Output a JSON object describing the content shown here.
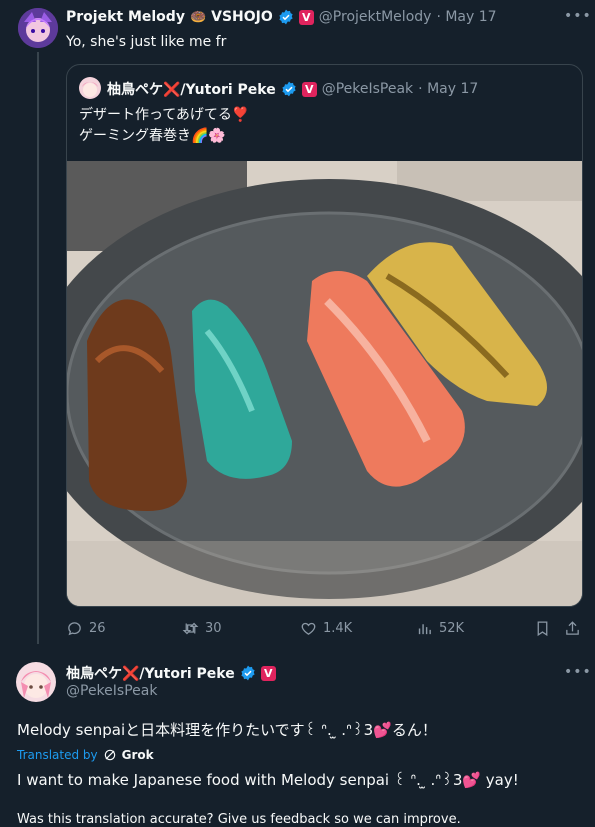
{
  "tweet1": {
    "author_name": "Projekt Melody",
    "author_suffix": "VSHOJO",
    "handle": "@ProjektMelody",
    "date": "· May 17",
    "text": "Yo, she's just like me fr",
    "affiliation_badge": "V"
  },
  "quoted": {
    "author_name": "柚鳥ペケ❌/Yutori Peke",
    "handle": "@PekeIsPeak",
    "date": "· May 17",
    "line1": "デザート作ってあげてる❣️",
    "line2": "ゲーミング春巻き🌈🌸",
    "affiliation_badge": "V"
  },
  "actions": {
    "replies": "26",
    "retweets": "30",
    "likes": "1.4K",
    "views": "52K"
  },
  "tweet2": {
    "author_name": "柚鳥ペケ❌/Yutori Peke",
    "handle": "@PekeIsPeak",
    "text": "Melody senpaiと日本料理を作りたいです꒰ ᐢ. ̫ .ᐢ꒱3💕るん！",
    "translated_by": "Translated by",
    "grok": "Grok",
    "translation": "I want to make Japanese food with Melody senpai ꒰ ᐢ. ̫ .ᐢ꒱3💕 yay!",
    "feedback": "Was this translation accurate? Give us feedback so we can improve.",
    "affiliation_badge": "V"
  },
  "colors": {
    "background": "#15202b",
    "text": "#f7f9f9",
    "muted": "#8b98a5",
    "link": "#1d9bf0",
    "border": "#38444d",
    "affiliation": "#e0245e"
  }
}
